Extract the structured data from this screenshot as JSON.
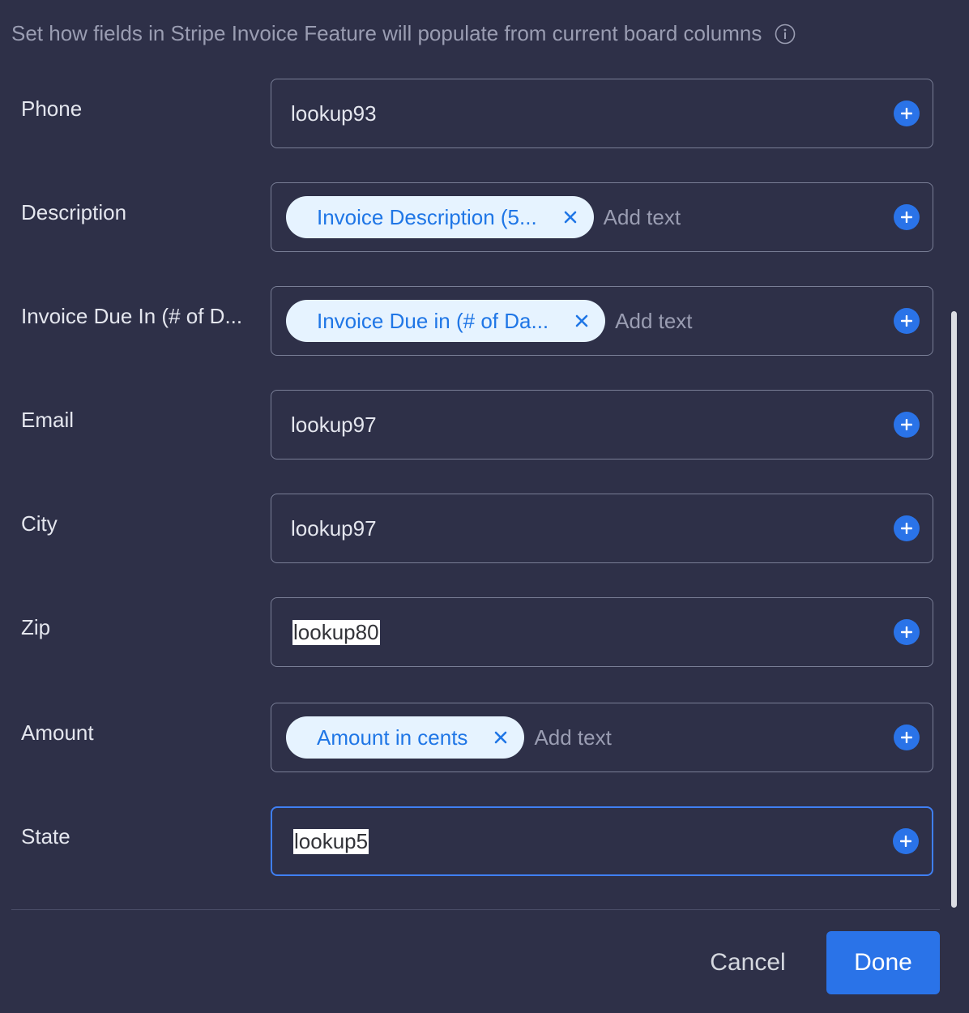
{
  "header": {
    "subtitle": "Set how fields in Stripe Invoice Feature will populate from current board columns",
    "info_icon": "info-circle-icon"
  },
  "fields": [
    {
      "label": "Phone",
      "value": "lookup93"
    },
    {
      "label": "Description",
      "chip": "Invoice Description (5...",
      "add_text": "Add text"
    },
    {
      "label": "Invoice Due In (# of D...",
      "chip": "Invoice Due in (# of Da...",
      "add_text": "Add text"
    },
    {
      "label": "Email",
      "value": "lookup97"
    },
    {
      "label": "City",
      "value": "lookup97"
    },
    {
      "label": "Zip",
      "value": "lookup80"
    },
    {
      "label": "Amount",
      "chip": "Amount in cents",
      "add_text": "Add text"
    },
    {
      "label": "State",
      "value": "lookup5"
    }
  ],
  "footer": {
    "cancel_label": "Cancel",
    "done_label": "Done"
  },
  "colors": {
    "background": "#2e3048",
    "accent": "#2a73e8",
    "chip_bg": "#e6f3ff",
    "chip_text": "#1f76e6",
    "border": "#797e96",
    "focus_border": "#3f7ff3"
  }
}
